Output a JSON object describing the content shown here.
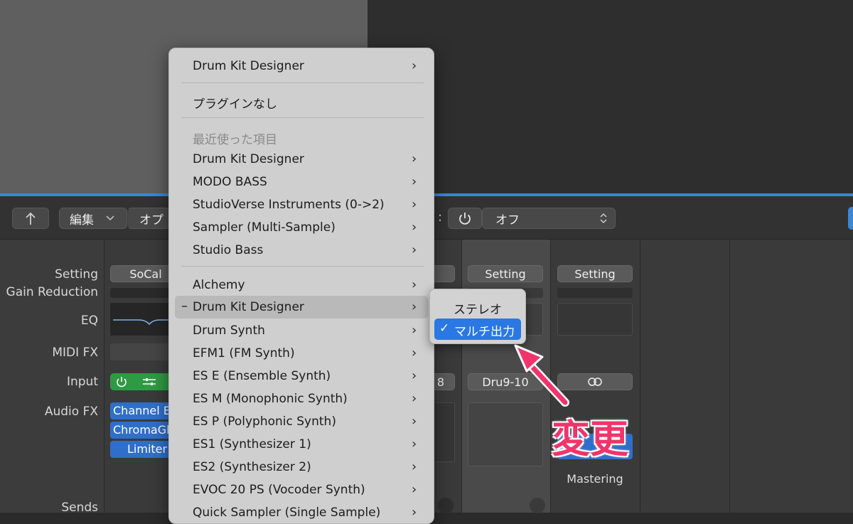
{
  "toolbar": {
    "back_icon": "up-arrow-icon",
    "edit_label": "編集",
    "options_label": "オプ",
    "colon_char": ":",
    "power_icon": "power-icon",
    "off_label": "オフ"
  },
  "row_labels": [
    "Setting",
    "Gain Reduction",
    "EQ",
    "MIDI FX",
    "Input",
    "Audio FX",
    "Sends"
  ],
  "strip1": {
    "setting": "SoCal",
    "fx": [
      "Channel E",
      "ChromaGl",
      "Limiter"
    ]
  },
  "strip_partial": {
    "input_tail": "8"
  },
  "strip3": {
    "setting": "Setting",
    "input": "Dru9-10"
  },
  "strip4": {
    "setting": "Setting",
    "input_icon": "stereo-link-icon",
    "name": "Mastering"
  },
  "menu": {
    "items": [
      {
        "label": "Drum Kit Designer",
        "arrow": true
      },
      {
        "label": "プラグインなし",
        "arrow": false
      },
      {
        "label": "最近使った項目",
        "arrow": false,
        "section": true
      },
      {
        "label": "Drum Kit Designer",
        "arrow": true
      },
      {
        "label": "MODO BASS",
        "arrow": true
      },
      {
        "label": "StudioVerse Instruments (0->2)",
        "arrow": true
      },
      {
        "label": "Sampler (Multi-Sample)",
        "arrow": true
      },
      {
        "label": "Studio Bass",
        "arrow": true
      },
      {
        "label": "Alchemy",
        "arrow": true
      },
      {
        "label": "Drum Kit Designer",
        "arrow": true,
        "highlighted": true
      },
      {
        "label": "Drum Synth",
        "arrow": true
      },
      {
        "label": "EFM1 (FM Synth)",
        "arrow": true
      },
      {
        "label": "ES E (Ensemble Synth)",
        "arrow": true
      },
      {
        "label": "ES M (Monophonic Synth)",
        "arrow": true
      },
      {
        "label": "ES P (Polyphonic Synth)",
        "arrow": true
      },
      {
        "label": "ES1 (Synthesizer 1)",
        "arrow": true
      },
      {
        "label": "ES2 (Synthesizer 2)",
        "arrow": true
      },
      {
        "label": "EVOC 20 PS (Vocoder Synth)",
        "arrow": true
      },
      {
        "label": "Quick Sampler (Single Sample)",
        "arrow": true
      }
    ],
    "chevron": "›",
    "dash": "–"
  },
  "submenu": {
    "stereo": "ステレオ",
    "multi": "マルチ出力",
    "check": "✓"
  },
  "callout": "変更",
  "colors": {
    "accent": "#2a78e4",
    "callout": "#f2346c",
    "fx_blue": "#2f6fc9",
    "input_green": "#2f9a44"
  }
}
